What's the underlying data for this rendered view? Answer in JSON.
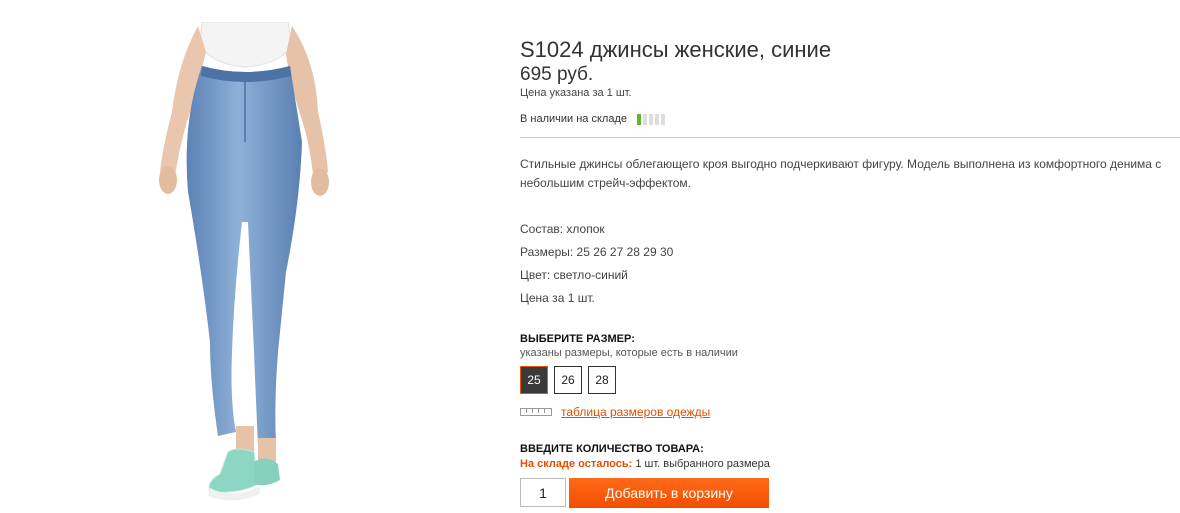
{
  "product": {
    "image_alt": "jeans-photo",
    "title": "S1024 джинсы женские, синие",
    "price": "695 руб.",
    "price_note": "Цена указана за 1 шт.",
    "stock_label": "В наличии на складе",
    "stock_level": 0.2,
    "description": "Стильные джинсы облегающего кроя выгодно подчеркивают фигуру. Модель выполнена из комфортного денима с небольшим стрейч-эффектом.",
    "specs": {
      "composition": "Состав: хлопок",
      "sizes": "Размеры: 25 26 27 28 29 30",
      "color": "Цвет: светло-синий",
      "price_per": "Цена за 1 шт."
    }
  },
  "size_select": {
    "heading": "ВЫБЕРИТЕ РАЗМЕР:",
    "subtitle": "указаны размеры, которые есть в наличии",
    "options": [
      "25",
      "26",
      "28"
    ],
    "selected": "25",
    "size_table_link": "таблица размеров одежды"
  },
  "quantity": {
    "heading": "ВВЕДИТЕ КОЛИЧЕСТВО ТОВАРА:",
    "left_label": "На складе осталось:",
    "left_value": "1 шт. выбранного размера",
    "value": "1",
    "add_button": "Добавить в корзину"
  },
  "colors": {
    "accent": "#f24e00",
    "stock_on": "#5cb82e"
  }
}
